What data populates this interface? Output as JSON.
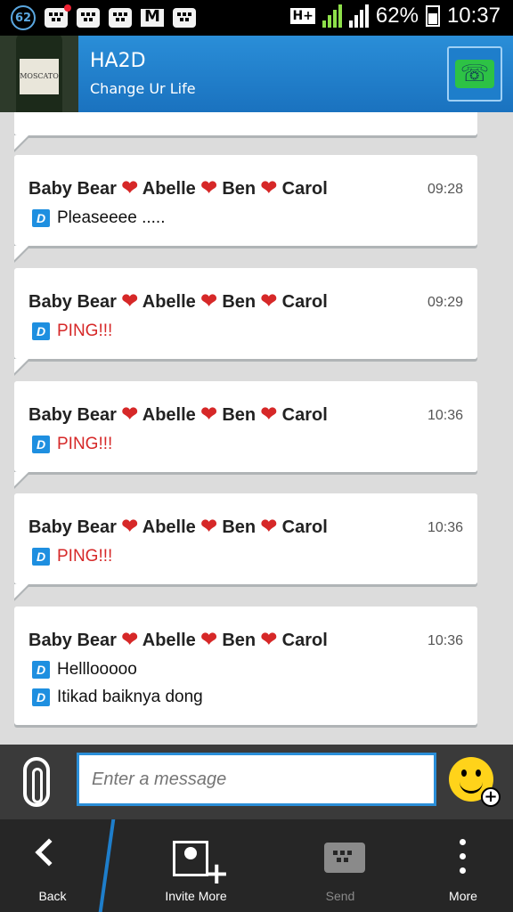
{
  "status_bar": {
    "notification_count": "62",
    "network": "H+",
    "battery_percent": "62%",
    "time": "10:37"
  },
  "header": {
    "title": "HA2D",
    "subtitle": "Change Ur Life",
    "avatar_label": "MOSCATO",
    "call_icon": "phone-call-icon"
  },
  "messages": [
    {
      "sender": "Baby Bear ❤ Abelle ❤ Ben ❤ Carol",
      "time": "09:28",
      "lines": [
        {
          "text": "Pleaseeee .....",
          "ping": false
        }
      ]
    },
    {
      "sender": "Baby Bear ❤ Abelle ❤ Ben ❤ Carol",
      "time": "09:29",
      "lines": [
        {
          "text": "PING!!!",
          "ping": true
        }
      ]
    },
    {
      "sender": "Baby Bear ❤ Abelle ❤ Ben ❤ Carol",
      "time": "10:36",
      "lines": [
        {
          "text": "PING!!!",
          "ping": true
        }
      ]
    },
    {
      "sender": "Baby Bear ❤ Abelle ❤ Ben ❤ Carol",
      "time": "10:36",
      "lines": [
        {
          "text": "PING!!!",
          "ping": true
        }
      ]
    },
    {
      "sender": "Baby Bear ❤ Abelle ❤ Ben ❤ Carol",
      "time": "10:36",
      "lines": [
        {
          "text": "Helllooooo",
          "ping": false
        },
        {
          "text": "Itikad baiknya dong",
          "ping": false
        }
      ]
    }
  ],
  "delivered_marker": "D",
  "input": {
    "placeholder": "Enter a message"
  },
  "bottom_bar": {
    "back": "Back",
    "invite": "Invite More",
    "send": "Send",
    "more": "More"
  },
  "colors": {
    "accent": "#2a8ed8",
    "ping_red": "#d62828",
    "delivered_blue": "#1e8fe0"
  }
}
